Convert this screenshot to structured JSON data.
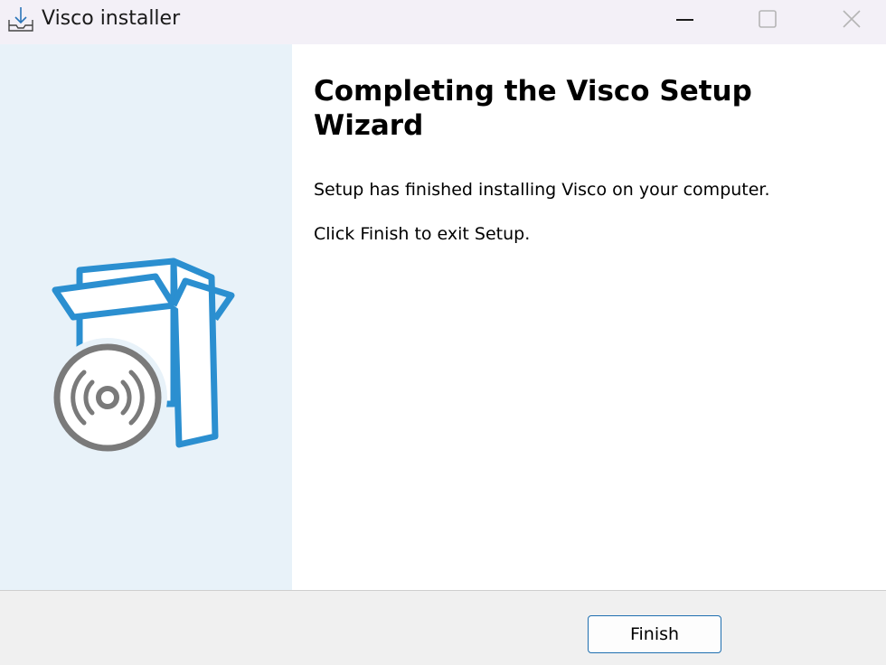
{
  "window": {
    "title": "Visco installer",
    "icon": "download-tray-icon",
    "controls": {
      "minimize_icon": "minimize-icon",
      "maximize_icon": "maximize-icon",
      "close_icon": "close-icon"
    }
  },
  "banner": {
    "graphic": "software-box-with-disc-icon",
    "colors": {
      "background": "#e8f2f9",
      "box_stroke": "#2b8fd0",
      "disc_stroke": "#7a7a7a"
    }
  },
  "content": {
    "heading": "Completing the Visco Setup Wizard",
    "message": "Setup has finished installing Visco on your computer.",
    "instruction": "Click Finish to exit Setup."
  },
  "footer": {
    "finish_label": "Finish"
  }
}
